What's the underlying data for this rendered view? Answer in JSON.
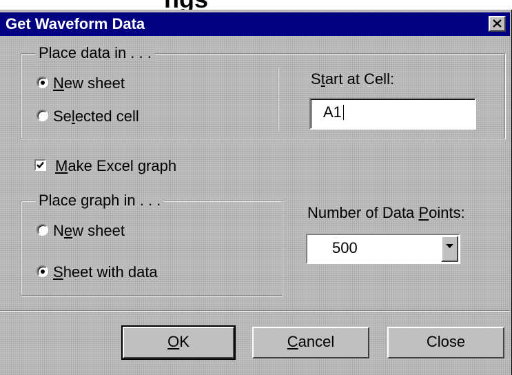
{
  "cutoff_heading": "ngs",
  "window": {
    "title": "Get Waveform Data",
    "close_icon": "close-icon"
  },
  "place_data": {
    "legend": "Place data in . . .",
    "options": [
      {
        "pre": "",
        "key": "N",
        "post": "ew sheet",
        "checked": true
      },
      {
        "pre": "Se",
        "key": "l",
        "post": "ected cell",
        "checked": false
      }
    ],
    "start_label": {
      "pre": "S",
      "key": "t",
      "post": "art at Cell:"
    },
    "start_value": "A1"
  },
  "make_graph": {
    "pre": "",
    "key": "M",
    "post": "ake Excel graph",
    "checked": true
  },
  "place_graph": {
    "legend": "Place graph in . . .",
    "options": [
      {
        "pre": "N",
        "key": "e",
        "post": "w sheet",
        "checked": false
      },
      {
        "pre": "",
        "key": "S",
        "post": "heet with data",
        "checked": true
      }
    ]
  },
  "data_points": {
    "label": {
      "pre": "Number of Data ",
      "key": "P",
      "post": "oints:"
    },
    "value": "500",
    "dropdown_icon": "chevron-down-icon"
  },
  "buttons": [
    {
      "pre": "",
      "key": "O",
      "post": "K"
    },
    {
      "pre": "",
      "key": "C",
      "post": "ancel"
    },
    {
      "pre": "Close",
      "key": "",
      "post": ""
    }
  ]
}
